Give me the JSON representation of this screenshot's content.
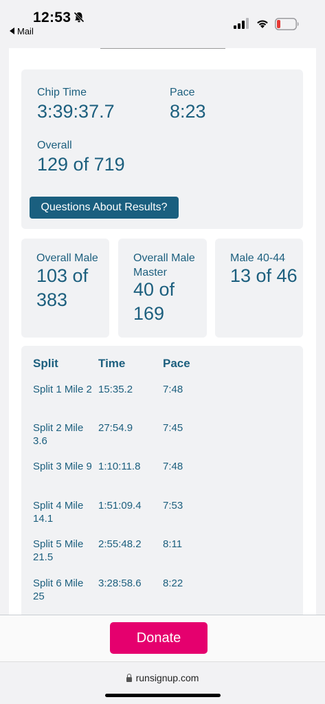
{
  "status_bar": {
    "time": "12:53",
    "back_label": "Mail"
  },
  "summary": {
    "chip_time_label": "Chip Time",
    "chip_time_value": "3:39:37.7",
    "pace_label": "Pace",
    "pace_value": "8:23",
    "overall_label": "Overall",
    "overall_value": "129 of 719",
    "questions_button": "Questions About Results?"
  },
  "placements": [
    {
      "label": "Overall Male",
      "value": "103 of 383"
    },
    {
      "label": "Overall Male Master",
      "value": "40 of 169"
    },
    {
      "label": "Male 40-44",
      "value": "13 of 46"
    }
  ],
  "splits": {
    "headers": [
      "Split",
      "Time",
      "Pace"
    ],
    "rows": [
      {
        "split": "Split 1 Mile 2",
        "time": "15:35.2",
        "pace": "7:48"
      },
      {
        "split": "Split 2 Mile 3.6",
        "time": "27:54.9",
        "pace": "7:45"
      },
      {
        "split": "Split 3 Mile 9",
        "time": "1:10:11.8",
        "pace": "7:48"
      },
      {
        "split": "Split 4 Mile 14.1",
        "time": "1:51:09.4",
        "pace": "7:53"
      },
      {
        "split": "Split 5 Mile 21.5",
        "time": "2:55:48.2",
        "pace": "8:11"
      },
      {
        "split": "Split 6 Mile 25",
        "time": "3:28:58.6",
        "pace": "8:22"
      }
    ]
  },
  "donate_button": "Donate",
  "url": "runsignup.com",
  "colors": {
    "accent": "#1c5f7e",
    "button": "#1a5f7f",
    "donate": "#e5006e",
    "card": "#f1f2f4"
  }
}
